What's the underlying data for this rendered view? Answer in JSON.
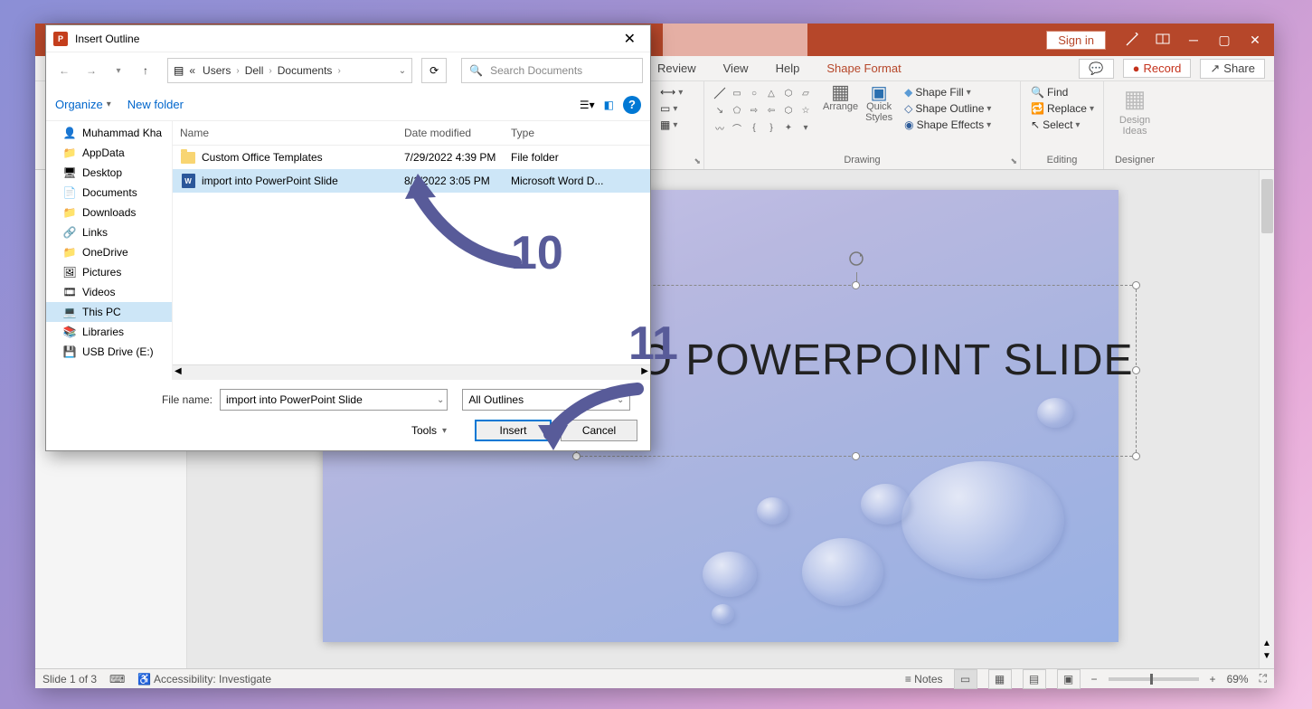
{
  "titleBar": {
    "signIn": "Sign in"
  },
  "ribbonTabs": {
    "review": "Review",
    "view": "View",
    "help": "Help",
    "shapeFormat": "Shape Format",
    "record": "Record",
    "share": "Share"
  },
  "ribbon": {
    "drawing": "Drawing",
    "arrange": "Arrange",
    "quickStyles": "Quick\nStyles",
    "shapeFill": "Shape Fill",
    "shapeOutline": "Shape Outline",
    "shapeEffects": "Shape Effects",
    "editing": "Editing",
    "find": "Find",
    "replace": "Replace",
    "select": "Select",
    "designer": "Designer",
    "designIdeas": "Design\nIdeas"
  },
  "slide": {
    "title": "NTO POWERPOINT SLIDE"
  },
  "statusBar": {
    "slideInfo": "Slide 1 of 3",
    "accessibility": "Accessibility: Investigate",
    "notes": "Notes",
    "zoom": "69%"
  },
  "dialog": {
    "title": "Insert Outline",
    "breadcrumb": {
      "prefix": "«",
      "p1": "Users",
      "p2": "Dell",
      "p3": "Documents"
    },
    "searchPlaceholder": "Search Documents",
    "organize": "Organize",
    "newFolder": "New folder",
    "columns": {
      "name": "Name",
      "date": "Date modified",
      "type": "Type"
    },
    "tree": [
      {
        "icon": "user",
        "label": "Muhammad Kha"
      },
      {
        "icon": "folder",
        "label": "AppData"
      },
      {
        "icon": "desktop",
        "label": "Desktop"
      },
      {
        "icon": "doc",
        "label": "Documents"
      },
      {
        "icon": "folder",
        "label": "Downloads"
      },
      {
        "icon": "link",
        "label": "Links"
      },
      {
        "icon": "folder",
        "label": "OneDrive"
      },
      {
        "icon": "pic",
        "label": "Pictures"
      },
      {
        "icon": "vid",
        "label": "Videos"
      },
      {
        "icon": "pc",
        "label": "This PC",
        "selected": true
      },
      {
        "icon": "lib",
        "label": "Libraries"
      },
      {
        "icon": "usb",
        "label": "USB Drive (E:)"
      }
    ],
    "files": [
      {
        "icon": "folder",
        "name": "Custom Office Templates",
        "date": "7/29/2022 4:39 PM",
        "type": "File folder"
      },
      {
        "icon": "word",
        "name": "import into PowerPoint Slide",
        "date": "8/1/2022 3:05 PM",
        "type": "Microsoft Word D...",
        "selected": true
      }
    ],
    "fileNameLabel": "File name:",
    "fileName": "import into PowerPoint Slide",
    "filter": "All Outlines",
    "tools": "Tools",
    "insert": "Insert",
    "cancel": "Cancel"
  },
  "annotations": {
    "n10": "10",
    "n11": "11"
  }
}
